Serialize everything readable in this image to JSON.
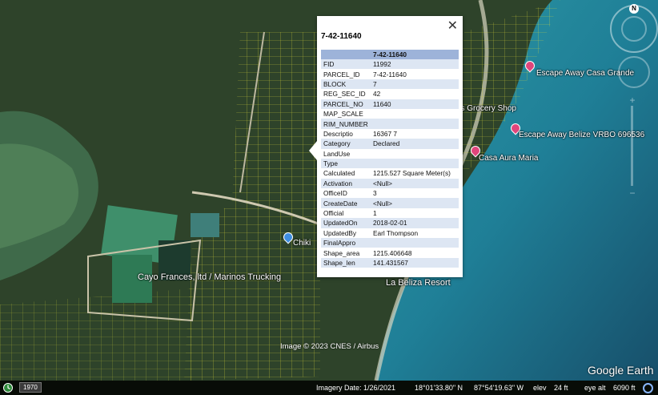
{
  "map": {
    "places": [
      {
        "name": "Escape Away Casa Grande"
      },
      {
        "name": "o's Grocery Shop"
      },
      {
        "name": "Escape Away Belize VRBO 696536"
      },
      {
        "name": "Casa Aura Maria"
      },
      {
        "name": "Chiki"
      },
      {
        "name": "Cayo Frances, ltd / Marinos Trucking"
      },
      {
        "name": "La Beliza Resort"
      }
    ],
    "copyright": "Image © 2023 CNES / Airbus",
    "logo": "Google Earth",
    "compass_label": "N"
  },
  "popup": {
    "title": "7-42-11640",
    "header": "7-42-11640",
    "close_icon": "close-icon",
    "rows": [
      {
        "key": "FID",
        "value": "11992"
      },
      {
        "key": "PARCEL_ID",
        "value": "7-42-11640"
      },
      {
        "key": "BLOCK",
        "value": "7"
      },
      {
        "key": "REG_SEC_ID",
        "value": "42"
      },
      {
        "key": "PARCEL_NO",
        "value": "11640"
      },
      {
        "key": "MAP_SCALE",
        "value": ""
      },
      {
        "key": "RIM_NUMBER",
        "value": ""
      },
      {
        "key": "Descriptio",
        "value": "16367 7"
      },
      {
        "key": "Category",
        "value": "Declared"
      },
      {
        "key": "LandUse",
        "value": ""
      },
      {
        "key": "Type",
        "value": ""
      },
      {
        "key": "Calculated",
        "value": "1215.527 Square Meter(s)"
      },
      {
        "key": "Activation",
        "value": "<Null>"
      },
      {
        "key": "OfficeID",
        "value": "3"
      },
      {
        "key": "CreateDate",
        "value": "<Null>"
      },
      {
        "key": "Official",
        "value": "1"
      },
      {
        "key": "UpdatedOn",
        "value": "2018-02-01"
      },
      {
        "key": "UpdatedBy",
        "value": "Earl Thompson"
      },
      {
        "key": "FinalAppro",
        "value": ""
      },
      {
        "key": "Shape_area",
        "value": "1215.406648"
      },
      {
        "key": "Shape_len",
        "value": "141.431567"
      }
    ]
  },
  "status": {
    "year": "1970",
    "imagery_date": "Imagery Date: 1/26/2021",
    "lat": "18°01'33.80\" N",
    "lon": "87°54'19.63\" W",
    "elev_label": "elev",
    "elev": "24 ft",
    "eye_label": "eye alt",
    "eye": "6090 ft"
  },
  "colors": {
    "parcel_lines": "#e6e63a",
    "sea": "#2f8f9a",
    "land": "#2d4a2a",
    "accent": "#9db3d9"
  }
}
